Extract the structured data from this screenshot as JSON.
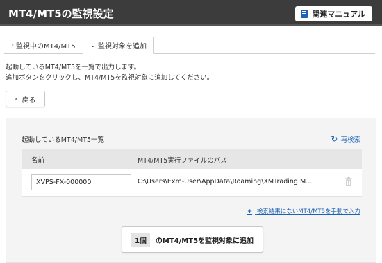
{
  "header": {
    "title": "MT4/MT5の監視設定",
    "manual_label": "関連マニュアル"
  },
  "tabs": [
    {
      "label": "監視中のMT4/MT5",
      "chevron": "›"
    },
    {
      "label": "監視対象を追加",
      "chevron": "⌄"
    }
  ],
  "description": {
    "line1": "起動しているMT4/MT5を一覧で出力します。",
    "line2": "追加ボタンをクリックし、MT4/MT5を監視対象に追加してください。"
  },
  "back_label": "戻る",
  "panel": {
    "title": "起動しているMT4/MT5一覧",
    "refresh_label": "再検索",
    "columns": {
      "name": "名前",
      "path": "MT4/MT5実行ファイルのパス"
    },
    "rows": [
      {
        "name": "XVPS-FX-000000",
        "path": "C:\\Users\\Exm-User\\AppData\\Roaming\\XMTrading M..."
      }
    ],
    "manual_entry_label": "検索結果にないMT4/MT5を手動で入力",
    "add_count": "1個",
    "add_label": "のMT4/MT5を監視対象に追加"
  }
}
